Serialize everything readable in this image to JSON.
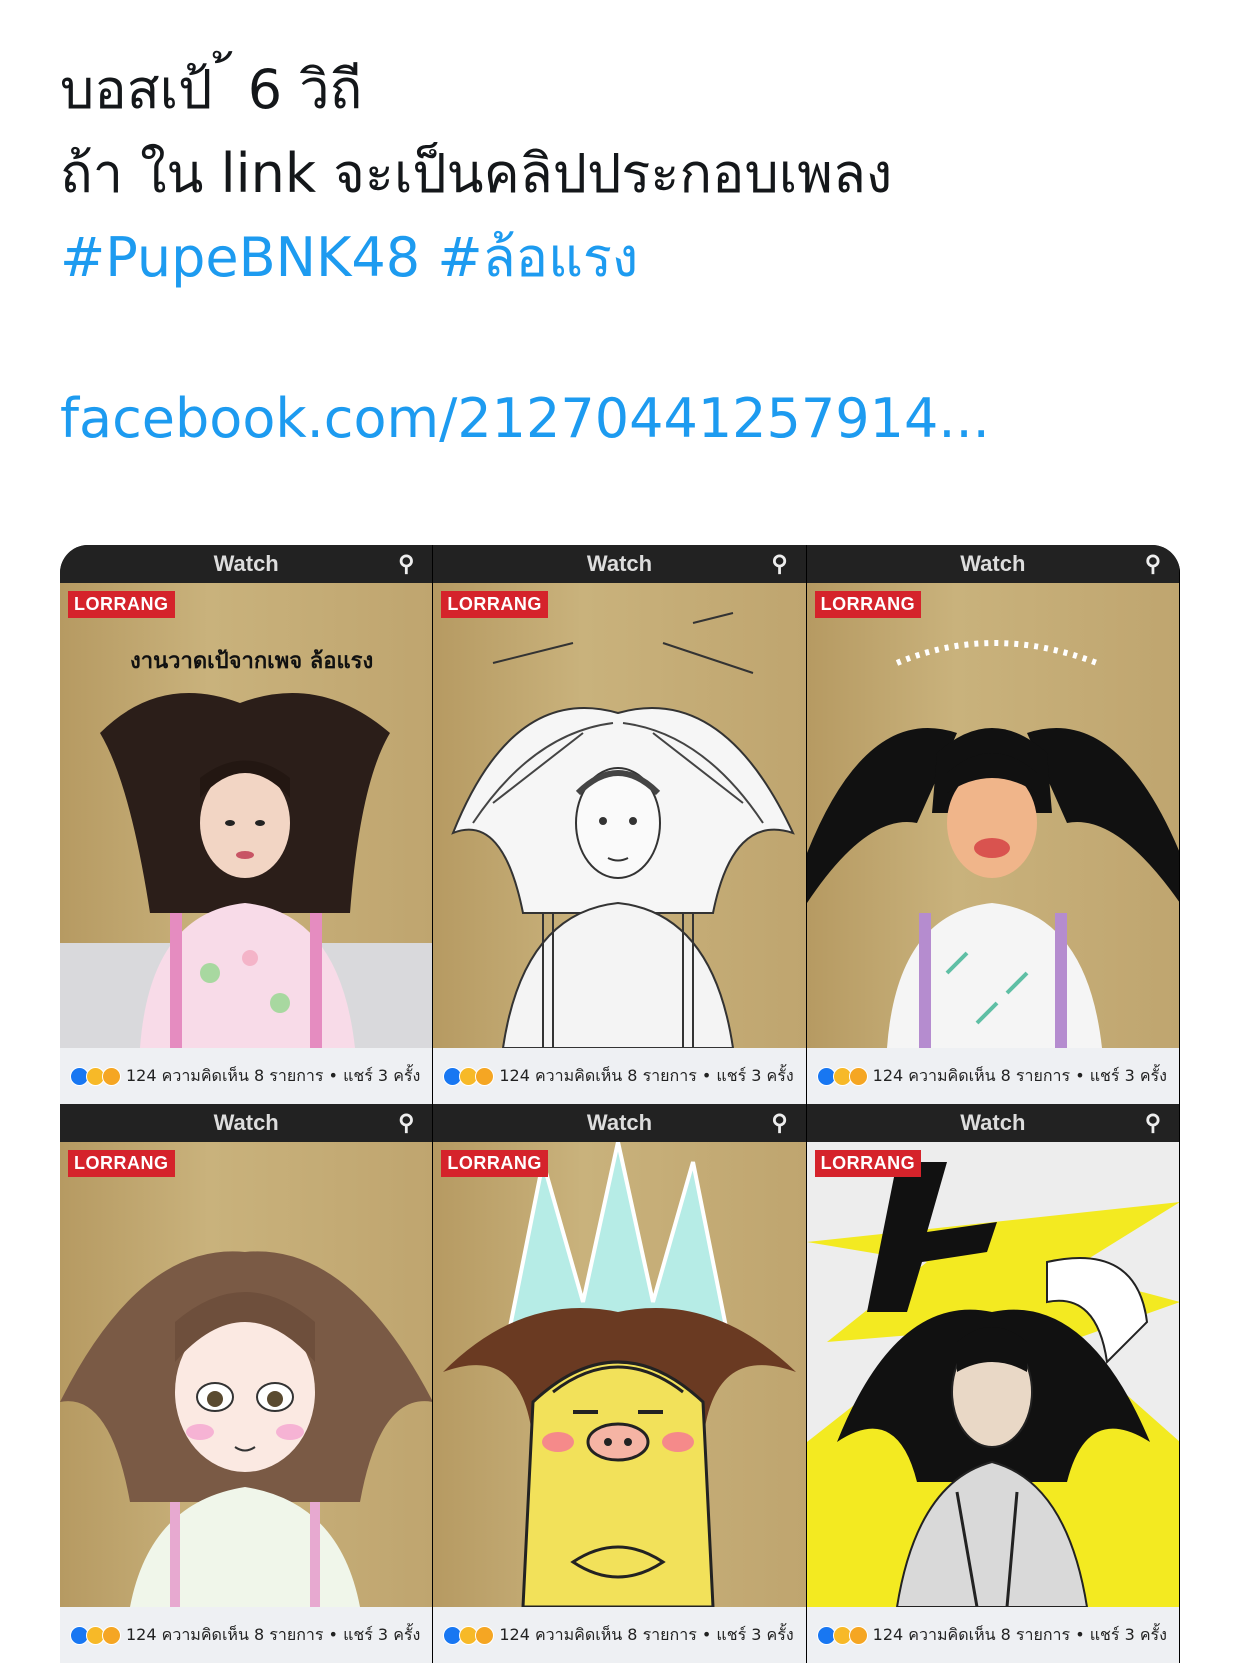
{
  "tweet": {
    "line1": "บอสเป้ ้ 6 วิถี",
    "line2": "ถ้า ใน link จะเป็นคลิปประกอบเพลง",
    "hashtag1": "#PupeBNK48",
    "hashtag2": "#ล้อแรง",
    "link": "facebook.com/21270441257914..."
  },
  "panels": [
    {
      "topbar": "Watch",
      "logo": "LORRANG",
      "overlay": "งานวาดเป้จากเพจ ล้อแรง",
      "stats": "124 ความคิดเห็น 8 รายการ • แชร์ 3 ครั้ง"
    },
    {
      "topbar": "Watch",
      "logo": "LORRANG",
      "overlay": "",
      "stats": "124 ความคิดเห็น 8 รายการ • แชร์ 3 ครั้ง"
    },
    {
      "topbar": "Watch",
      "logo": "LORRANG",
      "overlay": "",
      "stats": "124 ความคิดเห็น 8 รายการ • แชร์ 3 ครั้ง"
    },
    {
      "topbar": "Watch",
      "logo": "LORRANG",
      "overlay": "",
      "stats": "124 ความคิดเห็น 8 รายการ • แชร์ 3 ครั้ง"
    },
    {
      "topbar": "Watch",
      "logo": "LORRANG",
      "overlay": "",
      "stats": "124 ความคิดเห็น 8 รายการ • แชร์ 3 ครั้ง"
    },
    {
      "topbar": "Watch",
      "logo": "LORRANG",
      "overlay": "",
      "stats": "124 ความคิดเห็น 8 รายการ • แชร์ 3 ครั้ง"
    }
  ],
  "colors": {
    "link": "#1d9bf0",
    "logo": "#d5232b"
  },
  "icons": [
    "back-arrow-icon",
    "profile-icon",
    "search-icon",
    "like-reaction-icon",
    "love-reaction-icon",
    "wow-reaction-icon"
  ]
}
